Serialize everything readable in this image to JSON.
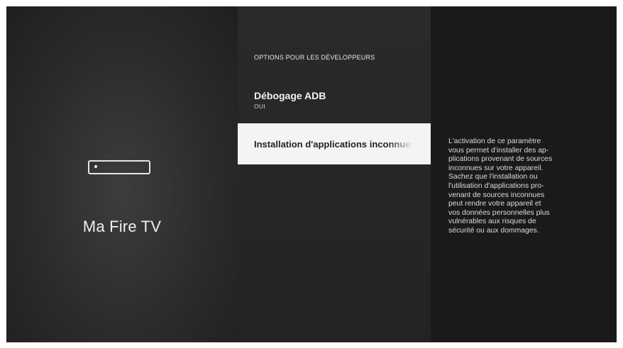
{
  "device_panel": {
    "icon": "fire-tv-device-icon",
    "name": "Ma Fire TV"
  },
  "menu": {
    "section_header": "OPTIONS POUR LES DÉVELOPPEURS",
    "items": [
      {
        "label": "Débogage ADB",
        "value": "OUI",
        "selected": false
      },
      {
        "label": "Installation d'applications inconnues",
        "selected": true
      }
    ]
  },
  "description": {
    "lines": [
      "L'activation de ce paramètre",
      "vous permet d'installer des ap-",
      "plications provenant de sources",
      "inconnues sur votre appareil.",
      "Sachez que l'installation ou",
      "l'utilisation d'applications pro-",
      "venant de sources inconnues",
      "peut rendre votre appareil et",
      "vos données personnelles plus",
      "vulnérables aux risques de",
      "sécurité ou aux dommages."
    ]
  }
}
